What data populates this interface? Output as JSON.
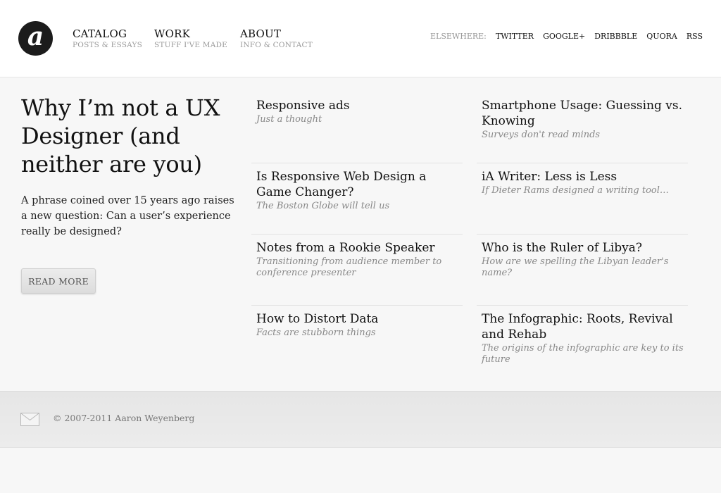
{
  "logo": {
    "glyph": "a"
  },
  "nav": [
    {
      "title": "CATALOG",
      "sub": "POSTS & ESSAYS"
    },
    {
      "title": "WORK",
      "sub": "STUFF I'VE MADE"
    },
    {
      "title": "ABOUT",
      "sub": "INFO & CONTACT"
    }
  ],
  "elsewhere": {
    "label": "ELSEWHERE:",
    "links": [
      "TWITTER",
      "GOOGLE+",
      "DRIBBBLE",
      "QUORA",
      "RSS"
    ]
  },
  "feature": {
    "title": "Why I’m not a UX Designer (and neither are you)",
    "excerpt": "A phrase coined over 15 years ago raises a new question: Can a user’s experience really be designed?",
    "button_label": "READ MORE"
  },
  "posts": [
    {
      "title": "Responsive ads",
      "sub": "Just a thought"
    },
    {
      "title": "Smartphone Usage: Guessing vs. Knowing",
      "sub": "Surveys don't read minds"
    },
    {
      "title": "Is Responsive Web Design a Game Changer?",
      "sub": "The Boston Globe will tell us"
    },
    {
      "title": "iA Writer: Less is Less",
      "sub": "If Dieter Rams designed a writing tool…"
    },
    {
      "title": "Notes from a Rookie Speaker",
      "sub": "Transitioning from audience member to conference presenter"
    },
    {
      "title": "Who is the Ruler of Libya?",
      "sub": "How are we spelling the Libyan leader's name?"
    },
    {
      "title": "How to Distort Data",
      "sub": "Facts are stubborn things"
    },
    {
      "title": "The Infographic: Roots, Revival and Rehab",
      "sub": "The origins of the infographic are key to its future"
    }
  ],
  "footer": {
    "copyright": "© 2007-2011 Aaron Weyenberg"
  },
  "colors": {
    "logo_bg": "#1c1c1c",
    "text": "#111111",
    "muted": "#999999",
    "sub": "#888888"
  }
}
